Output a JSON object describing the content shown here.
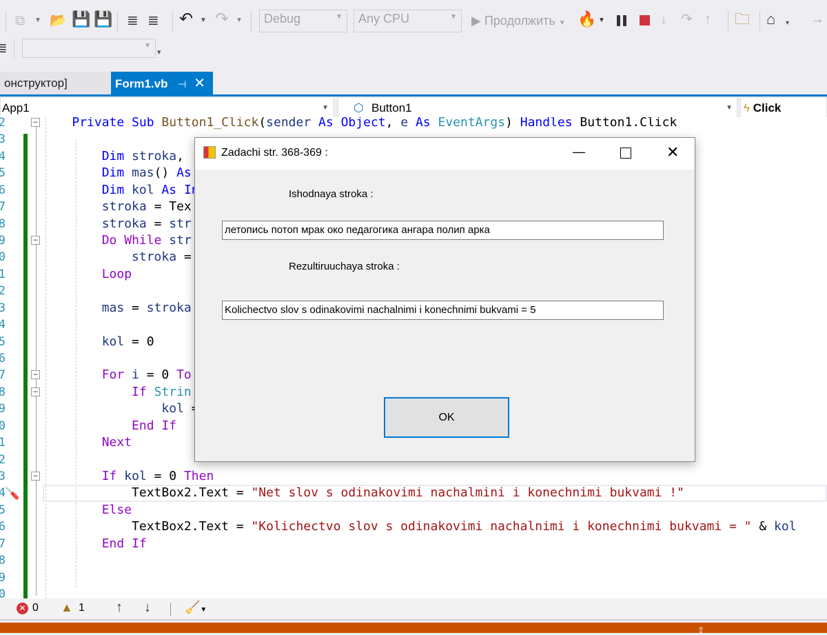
{
  "toolbar": {
    "config_combo": "Debug",
    "platform_combo": "Any CPU",
    "continue_label": "Продолжить"
  },
  "tabs": [
    {
      "label": "онструктор]",
      "active": false
    },
    {
      "label": "Form1.vb",
      "active": true
    }
  ],
  "navbar": {
    "project": "App1",
    "object": "Button1",
    "event": "Click"
  },
  "line_numbers": [
    "2",
    "3",
    "4",
    "5",
    "6",
    "7",
    "8",
    "9",
    "0",
    "1",
    "2",
    "3",
    "4",
    "5",
    "6",
    "7",
    "8",
    "9",
    "0",
    "1",
    "2",
    "3",
    "4",
    "5",
    "6",
    "7",
    "8",
    "9",
    "0"
  ],
  "code": [
    [
      [
        "    ",
        "pl"
      ],
      [
        "Private",
        "kw"
      ],
      [
        " ",
        "pl"
      ],
      [
        "Sub",
        "kw"
      ],
      [
        " ",
        "pl"
      ],
      [
        "Button1_Click",
        "fn"
      ],
      [
        "(",
        "pl"
      ],
      [
        "sender",
        "id"
      ],
      [
        " ",
        "pl"
      ],
      [
        "As",
        "kw"
      ],
      [
        " ",
        "pl"
      ],
      [
        "Object",
        "kw"
      ],
      [
        ", ",
        "pl"
      ],
      [
        "e",
        "id"
      ],
      [
        " ",
        "pl"
      ],
      [
        "As",
        "kw"
      ],
      [
        " ",
        "pl"
      ],
      [
        "EventArgs",
        "ty"
      ],
      [
        ") ",
        "pl"
      ],
      [
        "Handles",
        "kw"
      ],
      [
        " Button1.Click",
        "pl"
      ]
    ],
    [],
    [
      [
        "        ",
        "pl"
      ],
      [
        "Dim",
        "kw"
      ],
      [
        " ",
        "pl"
      ],
      [
        "stroka",
        "id"
      ],
      [
        ", ",
        "pl"
      ]
    ],
    [
      [
        "        ",
        "pl"
      ],
      [
        "Dim",
        "kw"
      ],
      [
        " ",
        "pl"
      ],
      [
        "mas",
        "id"
      ],
      [
        "() ",
        "pl"
      ],
      [
        "As",
        "kw"
      ]
    ],
    [
      [
        "        ",
        "pl"
      ],
      [
        "Dim",
        "kw"
      ],
      [
        " ",
        "pl"
      ],
      [
        "kol",
        "id"
      ],
      [
        " ",
        "pl"
      ],
      [
        "As",
        "kw"
      ],
      [
        " ",
        "pl"
      ],
      [
        "In",
        "kw"
      ]
    ],
    [
      [
        "        ",
        "pl"
      ],
      [
        "stroka",
        "id"
      ],
      [
        " = Tex",
        "pl"
      ]
    ],
    [
      [
        "        ",
        "pl"
      ],
      [
        "stroka",
        "id"
      ],
      [
        " = ",
        "pl"
      ],
      [
        "str",
        "id"
      ]
    ],
    [
      [
        "        ",
        "pl"
      ],
      [
        "Do",
        "ctl"
      ],
      [
        " ",
        "pl"
      ],
      [
        "While",
        "ctl"
      ],
      [
        " ",
        "pl"
      ],
      [
        "str",
        "id"
      ]
    ],
    [
      [
        "            ",
        "pl"
      ],
      [
        "stroka",
        "id"
      ],
      [
        " =",
        "pl"
      ]
    ],
    [
      [
        "        ",
        "pl"
      ],
      [
        "Loop",
        "ctl"
      ]
    ],
    [],
    [
      [
        "        ",
        "pl"
      ],
      [
        "mas",
        "id"
      ],
      [
        " = ",
        "pl"
      ],
      [
        "stroka",
        "id"
      ]
    ],
    [],
    [
      [
        "        ",
        "pl"
      ],
      [
        "kol",
        "id"
      ],
      [
        " = 0",
        "pl"
      ]
    ],
    [],
    [
      [
        "        ",
        "pl"
      ],
      [
        "For",
        "ctl"
      ],
      [
        " ",
        "pl"
      ],
      [
        "i",
        "id"
      ],
      [
        " = 0 ",
        "pl"
      ],
      [
        "To",
        "ctl"
      ]
    ],
    [
      [
        "            ",
        "pl"
      ],
      [
        "If",
        "ctl"
      ],
      [
        " ",
        "pl"
      ],
      [
        "Strin",
        "ty"
      ]
    ],
    [
      [
        "                ",
        "pl"
      ],
      [
        "kol",
        "id"
      ],
      [
        " =",
        "pl"
      ]
    ],
    [
      [
        "            ",
        "pl"
      ],
      [
        "End",
        "ctl"
      ],
      [
        " ",
        "pl"
      ],
      [
        "If",
        "ctl"
      ]
    ],
    [
      [
        "        ",
        "pl"
      ],
      [
        "Next",
        "ctl"
      ]
    ],
    [],
    [
      [
        "        ",
        "pl"
      ],
      [
        "If",
        "ctl"
      ],
      [
        " ",
        "pl"
      ],
      [
        "kol",
        "id"
      ],
      [
        " = 0 ",
        "pl"
      ],
      [
        "Then",
        "ctl"
      ]
    ],
    [
      [
        "            ",
        "pl"
      ],
      [
        "TextBox2.Text = ",
        "pl"
      ],
      [
        "\"Net slov s odinakovimi nachalmini i konechnimi bukvami !\"",
        "str"
      ]
    ],
    [
      [
        "        ",
        "pl"
      ],
      [
        "Else",
        "ctl"
      ]
    ],
    [
      [
        "            ",
        "pl"
      ],
      [
        "TextBox2.Text = ",
        "pl"
      ],
      [
        "\"Kolichectvo slov s odinakovimi nachalnimi i konechnimi bukvami = \"",
        "str"
      ],
      [
        " & ",
        "pl"
      ],
      [
        "kol",
        "id"
      ]
    ],
    [
      [
        "        ",
        "pl"
      ],
      [
        "End",
        "ctl"
      ],
      [
        " ",
        "pl"
      ],
      [
        "If",
        "ctl"
      ]
    ],
    [],
    [],
    []
  ],
  "dialog": {
    "title": "Zadachi str. 368-369 :",
    "label_input": "Ishodnaya stroka :",
    "input_value": "летопись  потоп мрак  око педагогика  ангара  полип  арка",
    "label_result": "Rezultiruuchaya stroka :",
    "result_value": "Kolichectvo slov s odinakovimi nachalnimi i konechnimi bukvami = 5",
    "ok_label": "OK"
  },
  "status": {
    "errors": "0",
    "warnings": "1"
  },
  "colors": {
    "accent": "#007acc",
    "change_bar": "#107c10",
    "bottom_bar": "#ca5100"
  }
}
